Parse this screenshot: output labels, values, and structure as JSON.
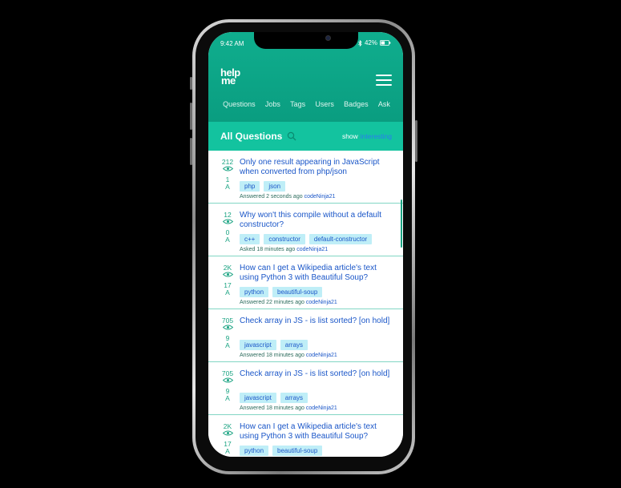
{
  "status": {
    "time": "9:42 AM",
    "battery": "42%"
  },
  "brand": {
    "line1": "help",
    "line2": "me"
  },
  "nav": [
    "Questions",
    "Jobs",
    "Tags",
    "Users",
    "Badges",
    "Ask"
  ],
  "section": {
    "title": "All Questions",
    "show_label": "show",
    "show_value": "interesting"
  },
  "questions": [
    {
      "views": "212",
      "answers": "1",
      "answer_letter": "A",
      "title": "Only one result appearing in JavaScript when converted from php/json",
      "tags": [
        "php",
        "json"
      ],
      "meta_action": "Answered 2 seconds ago",
      "user": "codeNinja21"
    },
    {
      "views": "12",
      "answers": "0",
      "answer_letter": "A",
      "title": "Why won't this compile without a default constructor?",
      "tags": [
        "c++",
        "constructor",
        "default-constructor"
      ],
      "meta_action": "Asked 18 minutes ago",
      "user": "codeNinja21"
    },
    {
      "views": "2K",
      "answers": "17",
      "answer_letter": "A",
      "title": "How can I get a Wikipedia article's text using Python 3 with Beautiful Soup?",
      "tags": [
        "python",
        "beautiful-soup"
      ],
      "meta_action": "Answered 22 minutes ago",
      "user": "codeNinja21"
    },
    {
      "views": "705",
      "answers": "9",
      "answer_letter": "A",
      "title": "Check array in JS - is list sorted? [on hold]",
      "tags": [
        "javascript",
        "arrays"
      ],
      "meta_action": "Answered 18 minutes ago",
      "user": "codeNinja21"
    },
    {
      "views": "705",
      "answers": "9",
      "answer_letter": "A",
      "title": "Check array in JS - is list sorted? [on hold]",
      "tags": [
        "javascript",
        "arrays"
      ],
      "meta_action": "Answered 18 minutes ago",
      "user": "codeNinja21"
    },
    {
      "views": "2K",
      "answers": "17",
      "answer_letter": "A",
      "title": "How can I get a Wikipedia article's text using Python 3 with Beautiful Soup?",
      "tags": [
        "python",
        "beautiful-soup"
      ],
      "meta_action": "",
      "user": ""
    }
  ],
  "colors": {
    "header": "#0fae8e",
    "section_bar": "#13c39f",
    "link": "#1a56c8",
    "tag_bg": "#bfeef7",
    "stat": "#1aa382"
  },
  "icons": {
    "menu": "hamburger-icon",
    "search": "search-icon",
    "views": "eye-icon",
    "wifi": "wifi-icon",
    "bluetooth": "bluetooth-icon",
    "battery": "battery-icon"
  }
}
